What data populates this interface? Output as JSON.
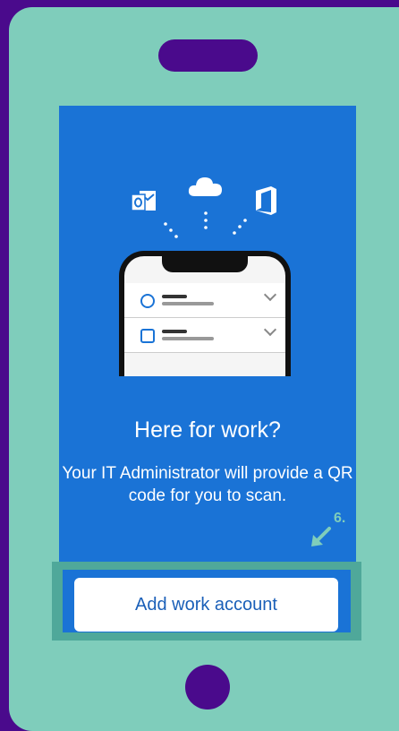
{
  "onboarding": {
    "title": "Here for work?",
    "description": "Your IT Administrator will provide a QR code for you to scan.",
    "button_label": "Add work account"
  },
  "annotation": {
    "step": "6."
  },
  "icons": [
    "outlook-icon",
    "onedrive-cloud-icon",
    "office-icon",
    "user-icon",
    "badge-icon",
    "chevron-down-icon",
    "arrow-icon"
  ],
  "colors": {
    "frame": "#4a0a8c",
    "device": "#7fcdbb",
    "screen": "#1a73d6",
    "highlight": "#4fa89a",
    "button_text": "#1a5fb8"
  }
}
